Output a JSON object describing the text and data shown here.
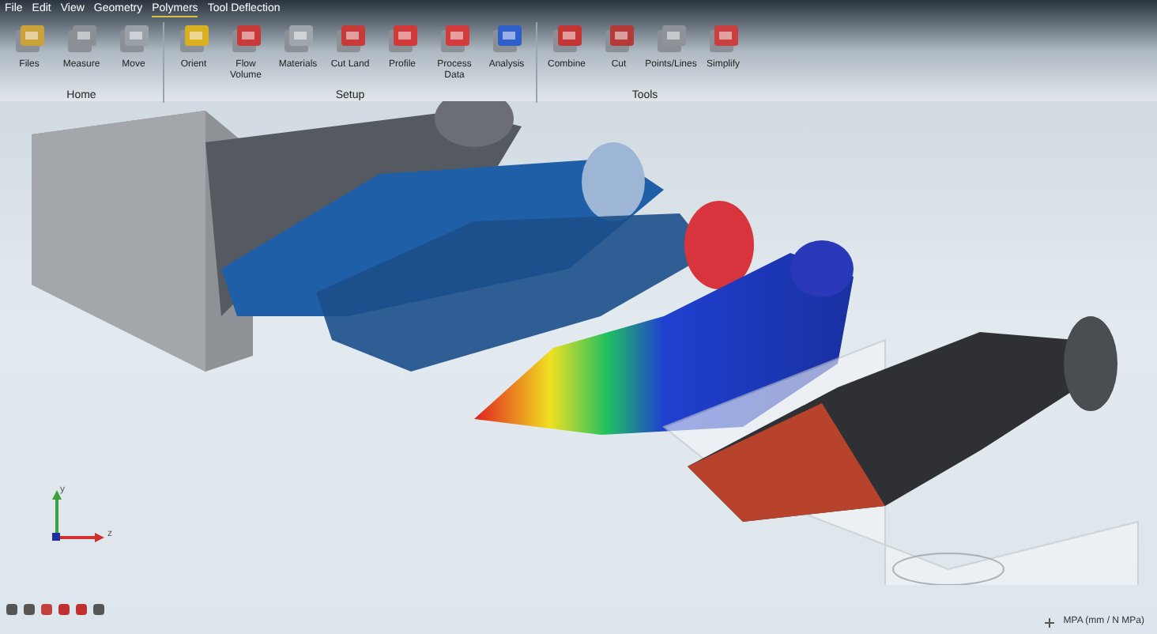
{
  "menu": [
    {
      "label": "File",
      "selected": false
    },
    {
      "label": "Edit",
      "selected": false
    },
    {
      "label": "View",
      "selected": false
    },
    {
      "label": "Geometry",
      "selected": false
    },
    {
      "label": "Polymers",
      "selected": true
    },
    {
      "label": "Tool Deflection",
      "selected": false
    }
  ],
  "groups": [
    {
      "label": "Home",
      "buttons": [
        "Files",
        "Measure",
        "Move"
      ]
    },
    {
      "label": "Setup",
      "buttons": [
        "Orient",
        "Flow Volume",
        "Materials",
        "Cut Land",
        "Profile",
        "Process\nData",
        "Analysis"
      ]
    },
    {
      "label": "Tools",
      "buttons": [
        "Combine",
        "Cut",
        "Points/Lines",
        "Simplify"
      ]
    }
  ],
  "triad": {
    "labels": [
      "y",
      "z"
    ]
  },
  "status_bar": {
    "units": "MPA (mm / N MPa)"
  }
}
